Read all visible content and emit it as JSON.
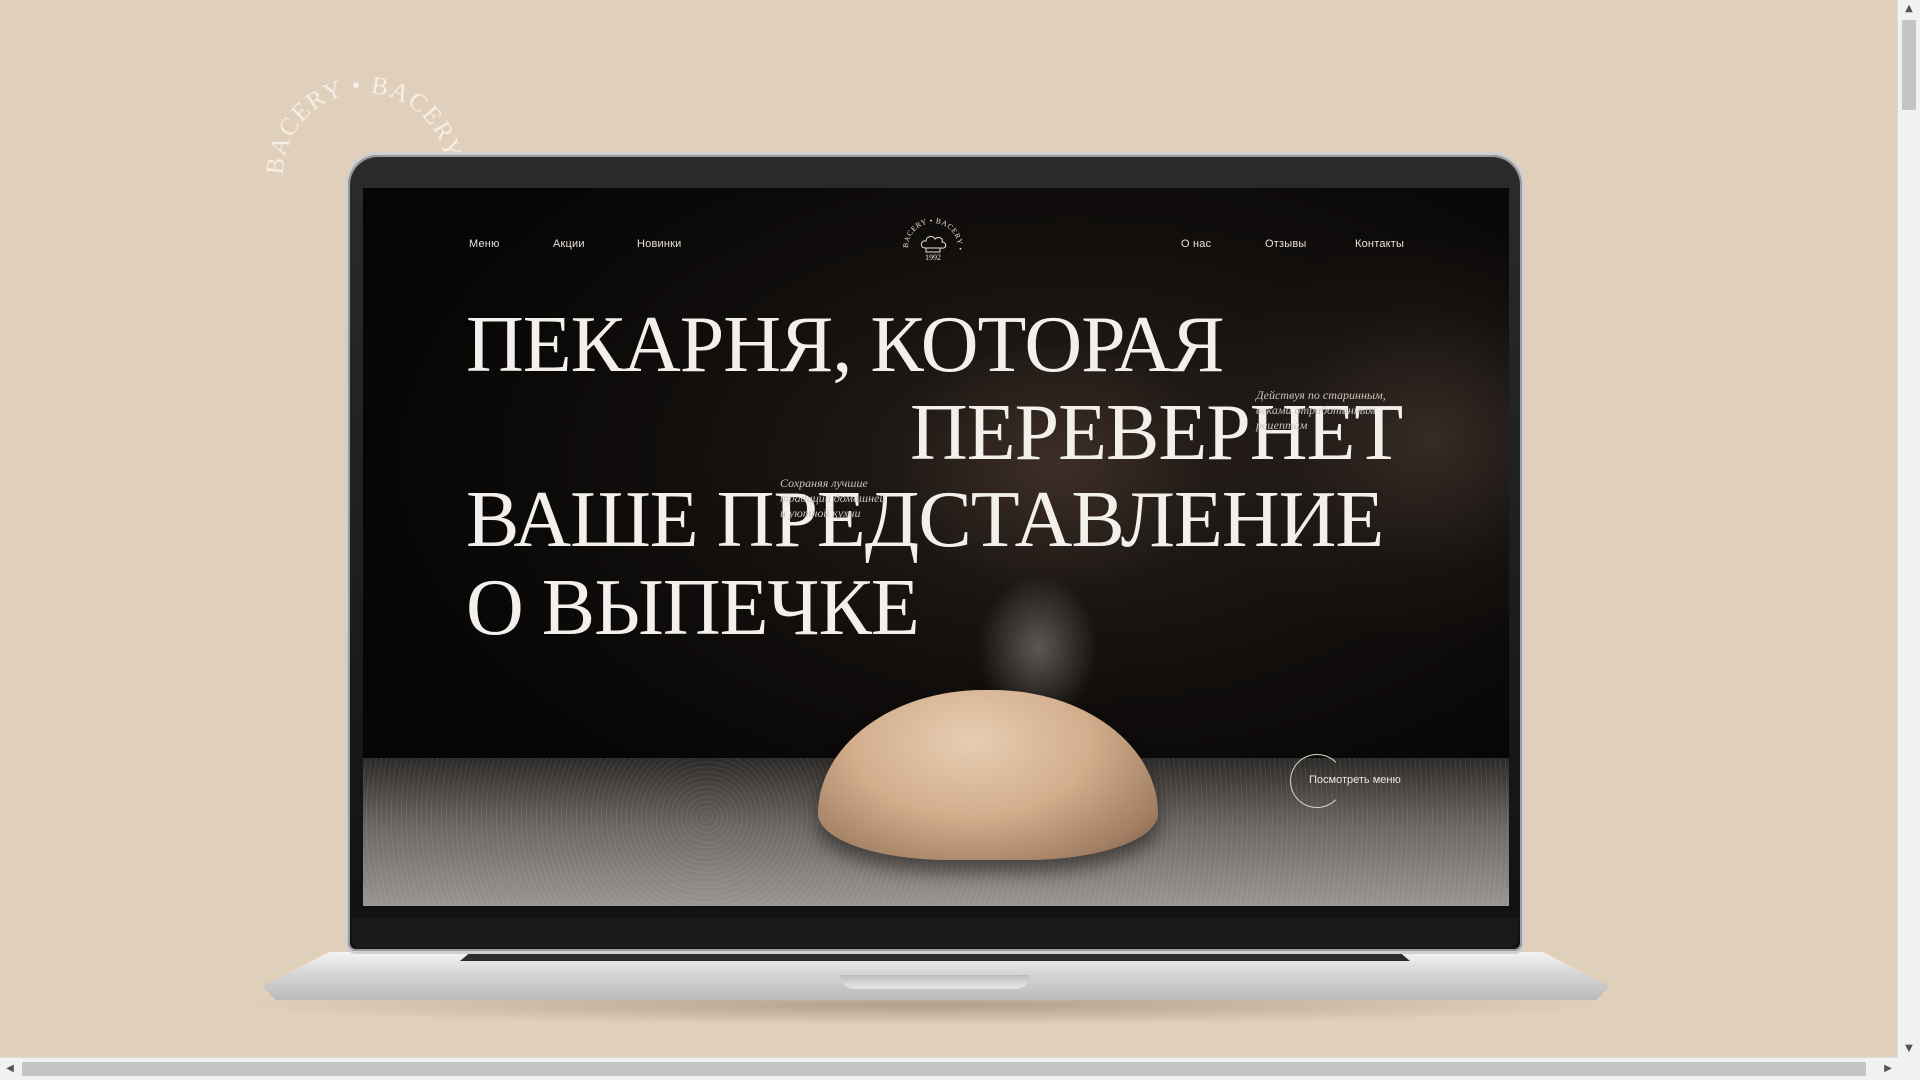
{
  "badge": {
    "text": "BACERY • BACERY • BACERY • "
  },
  "nav": {
    "left": [
      "Меню",
      "Акции",
      "Новинки"
    ],
    "right": [
      "О нас",
      "Отзывы",
      "Контакты"
    ]
  },
  "logo": {
    "ring_text": "BACERY • BACERY •",
    "year": "1992"
  },
  "hero": {
    "lines": [
      "ПЕКАРНЯ, КОТОРАЯ",
      "ПЕРЕВЕРНЕТ",
      "ВАШЕ ПРЕДСТАВЛЕНИЕ",
      "О ВЫПЕЧКЕ"
    ],
    "note_right": "Действуя по старинным,\nвеками отработанным\nрецептам",
    "note_left": "Сохраняя лучшие\nтрадиции домашней\nи уютной кухни"
  },
  "cta": {
    "label": "Посмотреть меню"
  },
  "scrollbars": {
    "up": "▲",
    "down": "▼",
    "left": "◀",
    "right": "▶"
  },
  "colors": {
    "background": "#e0cfbb",
    "screen": "#0b0908",
    "text": "#f3f0ec"
  }
}
